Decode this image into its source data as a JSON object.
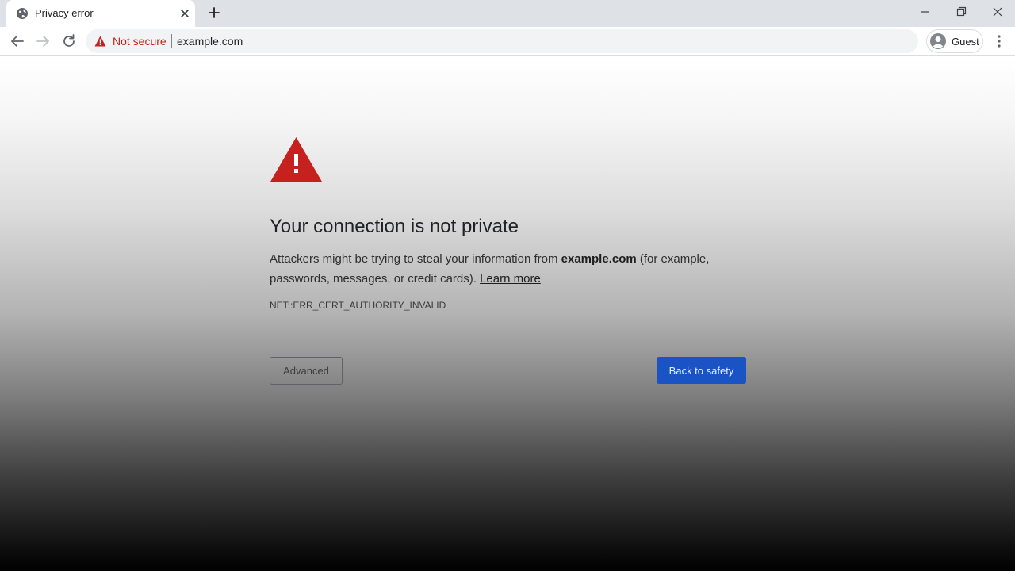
{
  "tab": {
    "title": "Privacy error",
    "favicon_icon": "globe-icon",
    "close_icon": "close-icon"
  },
  "new_tab_icon": "plus-icon",
  "window_controls": {
    "minimize_icon": "minimize-icon",
    "restore_icon": "restore-icon",
    "close_icon": "close-icon"
  },
  "toolbar": {
    "back_icon": "back-arrow-icon",
    "forward_icon": "forward-arrow-icon",
    "reload_icon": "reload-icon",
    "security_icon": "warning-triangle-icon",
    "security_label": "Not secure",
    "url": "example.com",
    "profile_icon": "avatar-icon",
    "profile_label": "Guest",
    "menu_icon": "kebab-menu-icon"
  },
  "interstitial": {
    "icon": "warning-triangle-icon",
    "heading": "Your connection is not private",
    "desc_before": "Attackers might be trying to steal your information from ",
    "desc_domain": "example.com",
    "desc_after": " (for example, passwords, messages, or credit cards). ",
    "learn_more": "Learn more",
    "error_code": "NET::ERR_CERT_AUTHORITY_INVALID",
    "advanced_label": "Advanced",
    "back_label": "Back to safety"
  },
  "colors": {
    "warning_red": "#c5221f",
    "primary_blue": "#1a54c4",
    "tabstrip_bg": "#dee1e6"
  }
}
